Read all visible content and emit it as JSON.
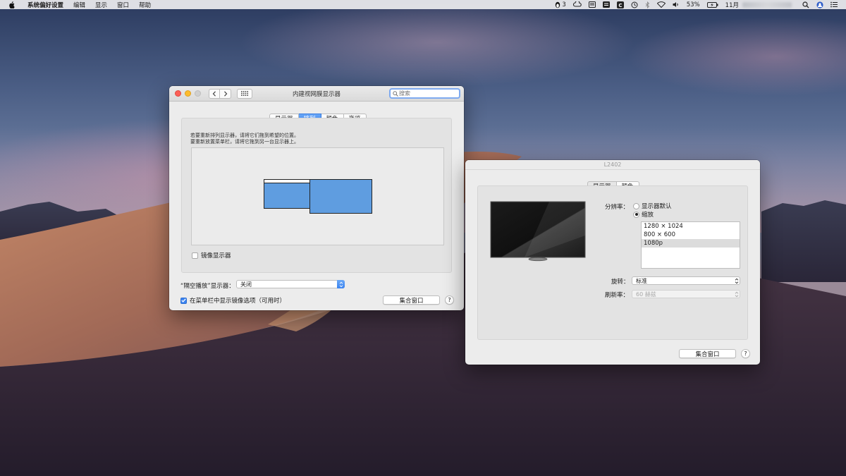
{
  "menubar": {
    "app_name": "系统偏好设置",
    "items": [
      "编辑",
      "显示",
      "窗口",
      "帮助"
    ],
    "status": {
      "notifications_count": "3",
      "battery_percent": "53%",
      "date_prefix": "11月"
    }
  },
  "window1": {
    "title": "内建视网膜显示器",
    "search_placeholder": "搜索",
    "tabs": [
      {
        "label": "显示器",
        "active": false
      },
      {
        "label": "排列",
        "active": true
      },
      {
        "label": "颜色",
        "active": false
      },
      {
        "label": "夜览",
        "active": false
      }
    ],
    "instruction_line1": "若要重新排列显示器，请将它们拖到希望的位置。",
    "instruction_line2": "要重新放置菜单栏，请将它拖到另一台显示器上。",
    "mirror_label": "镜像显示器",
    "mirror_checked": false,
    "airplay_label": "“隔空播放”显示器：",
    "airplay_value": "关闭",
    "show_mirror_label": "在菜单栏中显示镜像选项（可用时）",
    "show_mirror_checked": true,
    "gather_button": "集合窗口",
    "help_button": "?"
  },
  "window2": {
    "title": "L2402",
    "tabs": [
      {
        "label": "显示器",
        "active": true
      },
      {
        "label": "颜色",
        "active": false
      }
    ],
    "resolution_label": "分辨率：",
    "radio_default": "显示器默认",
    "radio_scaled": "缩放",
    "selected_radio": "scaled",
    "resolutions": [
      "1280 × 1024",
      "800 × 600",
      "1080p"
    ],
    "selected_resolution": "1080p",
    "rotation_label": "旋转：",
    "rotation_value": "标准",
    "refresh_label": "刷新率：",
    "refresh_value": "60 赫兹",
    "gather_button": "集合窗口",
    "help_button": "?"
  },
  "colors": {
    "accent": "#3b83f0",
    "display_block": "#5f9de0"
  }
}
